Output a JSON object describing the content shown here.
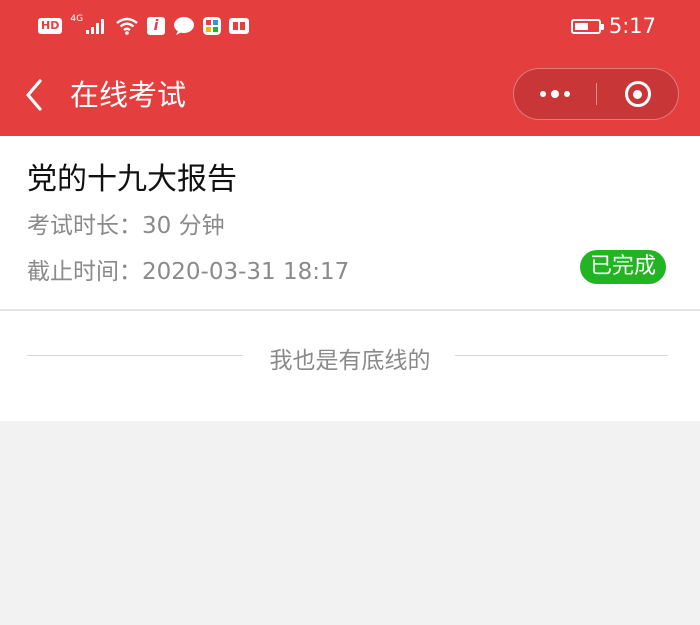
{
  "status_bar": {
    "hd_label": "HD",
    "network": "4G",
    "time": "5:17",
    "battery_level": 0.6
  },
  "nav": {
    "title": "在线考试"
  },
  "exam": {
    "title": "党的十九大报告",
    "duration": "考试时长：30 分钟",
    "deadline": "截止时间：2020-03-31 18:17",
    "status": "已完成"
  },
  "footer": {
    "text": "我也是有底线的"
  },
  "colors": {
    "brand": "#e53e3f",
    "status_complete": "#22b422"
  }
}
